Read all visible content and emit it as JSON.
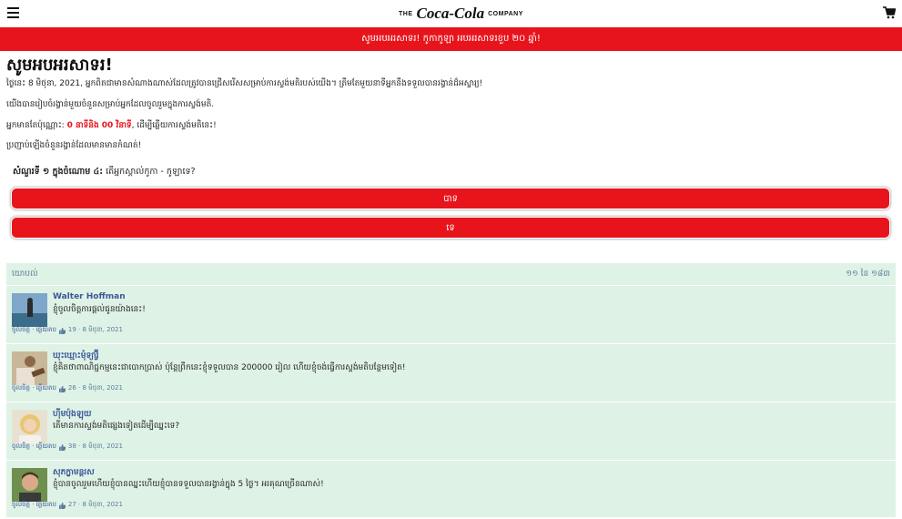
{
  "header": {
    "logo_prefix": "THE",
    "logo_script": "Coca-Cola",
    "logo_suffix": "COMPANY"
  },
  "banner": {
    "text": "សូមអបអរសាទរ! កូកាកូឡា អបអរសាទរខួប ២០ ឆ្នាំ!"
  },
  "main": {
    "title": "សូមអបអរសាទរ!",
    "p1": "ថ្ងៃនេះ 8 មិថុនា, 2021, អ្នកពិតជាមានសំណាងណាស់ដែលត្រូវបានជ្រើសរើសសម្រាប់ការស្ទង់មតិរបស់យើង។ ត្រឹមតែមួយនាទីអ្នកនឹងទទួលបានរង្វាន់ដ៏អស្ចារ្យ!",
    "p2": "យើងបានរៀបចំរង្វាន់មួយចំនួនសម្រាប់អ្នកដែលចូលរួមក្នុងការស្ទង់មតិ.",
    "p3_prefix": "អ្នកមានតែប៉ុណ្ណោះ:",
    "p3_highlight": "0 នាទីនិង 00 វិនាទី",
    "p3_suffix": ", ដើម្បីឆ្លើយការស្ទង់មតិនេះ!",
    "p4": "ប្រញាប់ឡើងចំនួនរង្វាន់ដែលមានមានកំណត់!"
  },
  "question": {
    "number": "សំណួរទី ១ ក្នុងចំណោម ៤:",
    "text": "តើអ្នកស្គាល់កូកា - កូឡាទេ?",
    "yes_label": "បាទ",
    "no_label": "ទេ"
  },
  "comments": {
    "header_label": "យោបល់",
    "header_count": "១១ នៃ ១៨៣",
    "items": [
      {
        "name": "Walter Hoffman",
        "text": "ខ្ញុំចូលចិត្តការផ្តល់ជូនយ៉ាងនេះ!",
        "like": "ចូលចិត្ត · ឆ្លើយតប",
        "meta": "19 · 8 មិថុនា, 2021"
      },
      {
        "name": "ឃុះឃ្មោះមុំទ្យារ្វ៊ី",
        "text": "ខ្ញុំគិតថាពាណិជ្ជកម្មនេះជាបោកប្រាស់ ប៉ុន្តែព្រឹកនេះខ្ញុំទទួលបាន 200000 រៀល ហើយខ្ញុំចង់ធ្វើការស្ទង់មតិបន្ថែមទៀត!",
        "like": "ចូលចិត្ត · ឆ្លើយតប",
        "meta": "26 · 8 មិថុនា, 2021"
      },
      {
        "name": "ហ៊ីមប៉ុងឡុយ",
        "text": "តើមានការស្ទង់មតិផ្សេងទៀតដើម្បីឈ្នះទេ?",
        "like": "ចូលចិត្ត · ឆ្លើយតប",
        "meta": "38 · 8 មិថុនា, 2021"
      },
      {
        "name": "សុភក្ខាមន្តរស",
        "text": "ខ្ញុំបានចូលរួមហើយខ្ញុំបានឈ្នះហើយខ្ញុំបានទទួលបានរង្វាន់ក្នុង 5 ថ្ងៃ។ អរគុណច្រើនណាស់!",
        "like": "ចូលចិត្ត · ឆ្លើយតប",
        "meta": "27 · 8 មិថុនា, 2021"
      }
    ]
  },
  "colors": {
    "brand_red": "#e8141c",
    "comment_bg": "#dff2e6",
    "name_blue": "#3b5998"
  },
  "icons": [
    "menu-icon",
    "cart-icon",
    "thumbs-up-icon"
  ]
}
